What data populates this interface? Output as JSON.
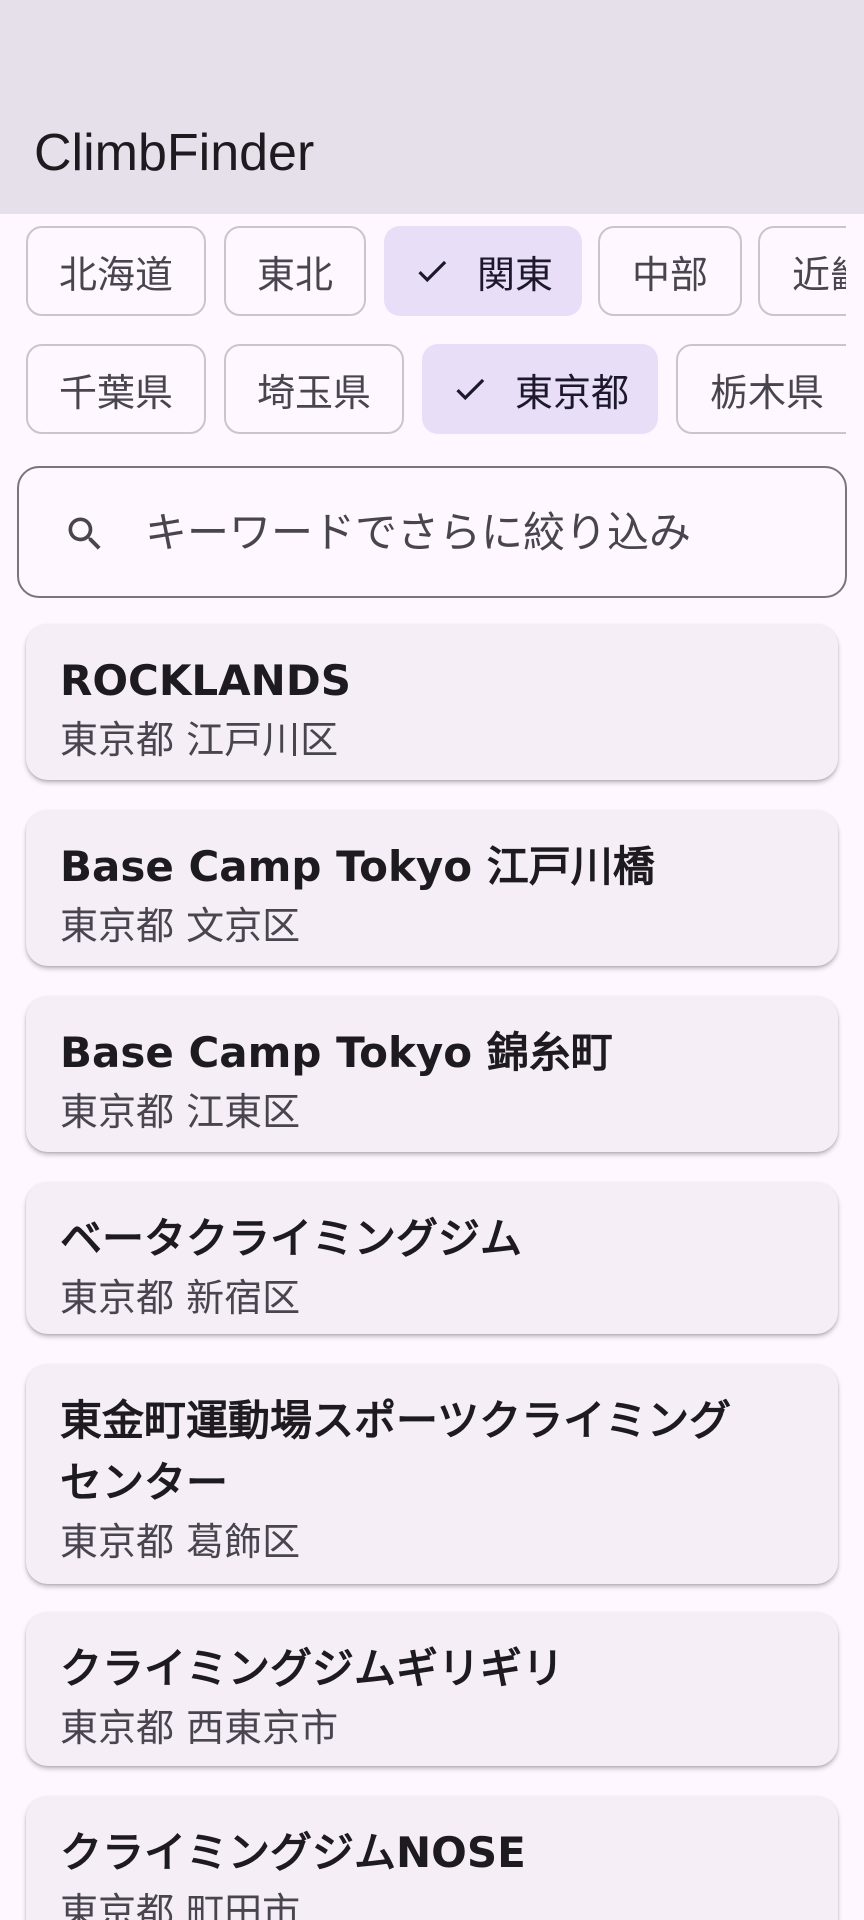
{
  "app": {
    "title": "ClimbFinder"
  },
  "regions": [
    {
      "label": "北海道",
      "selected": false
    },
    {
      "label": "東北",
      "selected": false
    },
    {
      "label": "関東",
      "selected": true
    },
    {
      "label": "中部",
      "selected": false
    },
    {
      "label": "近畿",
      "selected": false
    }
  ],
  "prefectures": [
    {
      "label": "千葉県",
      "selected": false
    },
    {
      "label": "埼玉県",
      "selected": false
    },
    {
      "label": "東京都",
      "selected": true
    },
    {
      "label": "栃木県",
      "selected": false
    }
  ],
  "search": {
    "placeholder": "キーワードでさらに絞り込み",
    "value": "",
    "icon": "search-icon"
  },
  "gyms": [
    {
      "name": "ROCKLANDS",
      "location": "東京都 江戸川区"
    },
    {
      "name": "Base Camp Tokyo 江戸川橋",
      "location": "東京都 文京区"
    },
    {
      "name": "Base Camp Tokyo 錦糸町",
      "location": "東京都 江東区"
    },
    {
      "name": "ベータクライミングジム",
      "location": "東京都 新宿区"
    },
    {
      "name": "東金町運動場スポーツクライミングセンター",
      "location": "東京都 葛飾区"
    },
    {
      "name": "クライミングジムギリギリ",
      "location": "東京都 西東京市"
    },
    {
      "name": "クライミングジムNOSE",
      "location": "東京都 町田市"
    }
  ],
  "colors": {
    "topbar": "#E6E0EA",
    "background": "#FEF7FF",
    "chip_selected": "#E8DEF8",
    "card": "#F5EEF7"
  }
}
